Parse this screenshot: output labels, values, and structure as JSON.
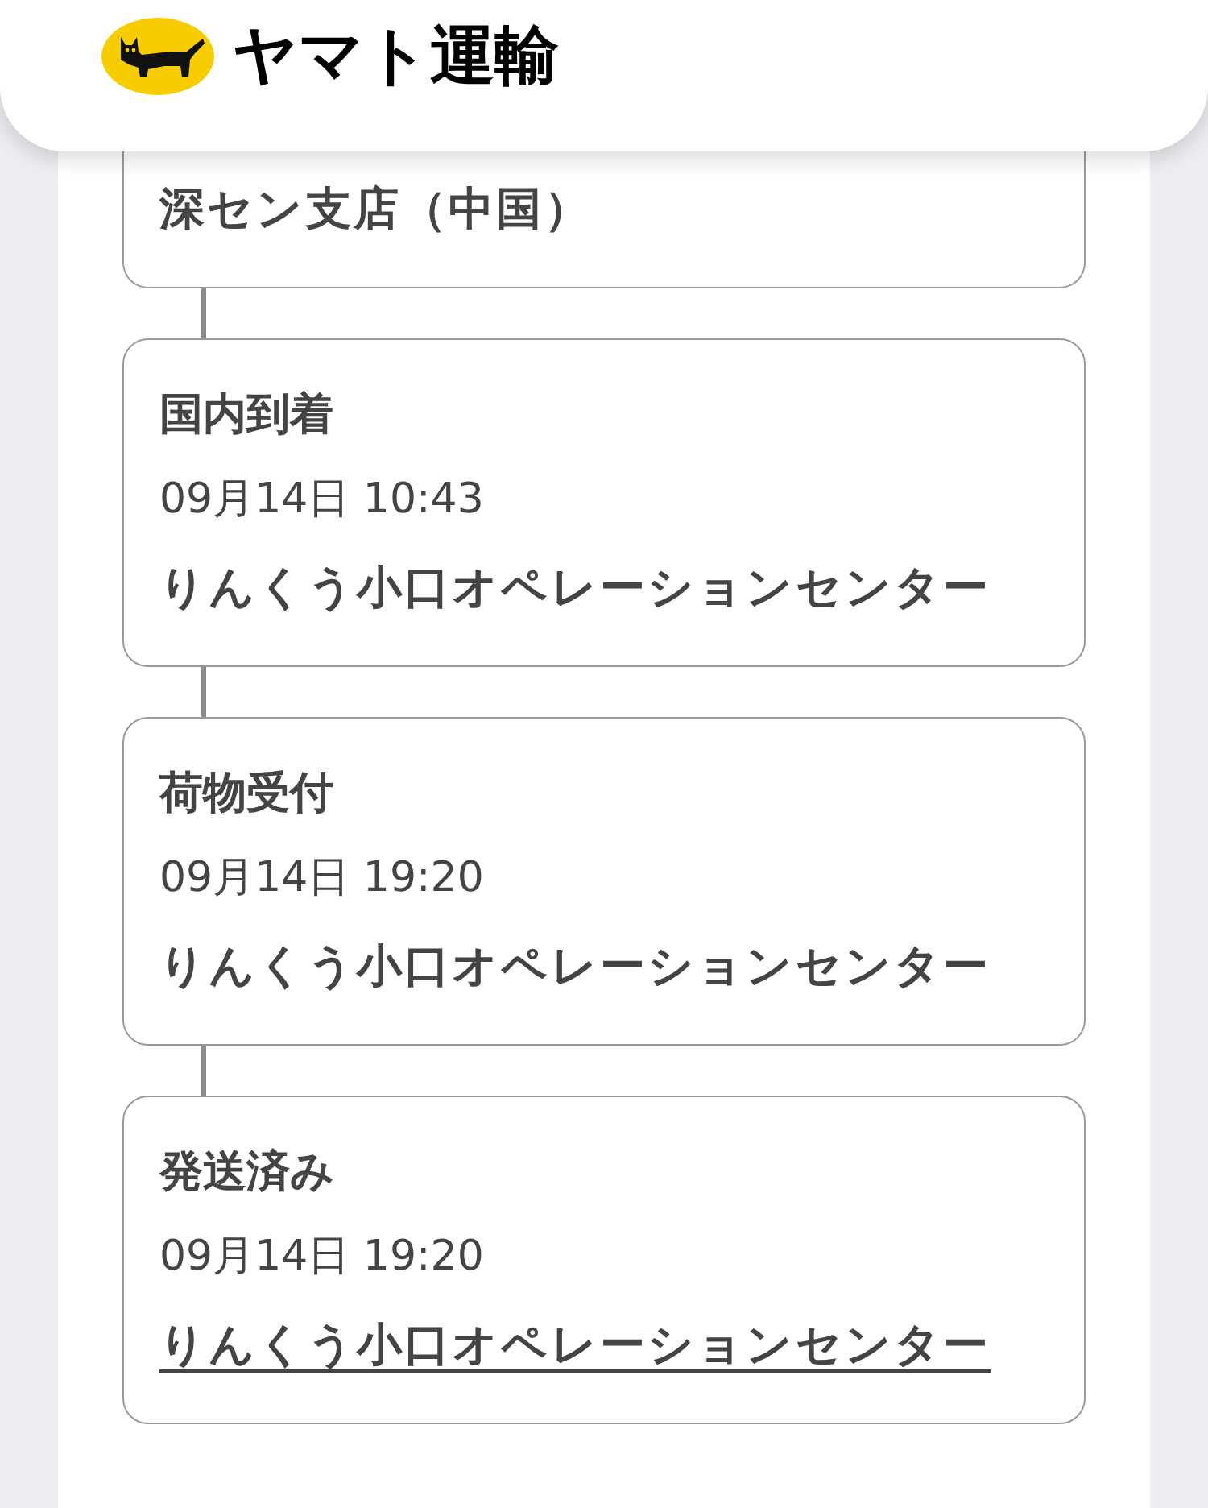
{
  "header": {
    "logo_text": "ヤマト運輸"
  },
  "events": [
    {
      "location": "深セン支店（中国）",
      "link": false
    },
    {
      "status": "国内到着",
      "time": "09月14日 10:43",
      "location": "りんくう小口オペレーションセンター",
      "link": false
    },
    {
      "status": "荷物受付",
      "time": "09月14日 19:20",
      "location": "りんくう小口オペレーションセンター",
      "link": false
    },
    {
      "status": "発送済み",
      "time": "09月14日 19:20",
      "location": "りんくう小口オペレーションセンター",
      "link": true
    }
  ]
}
